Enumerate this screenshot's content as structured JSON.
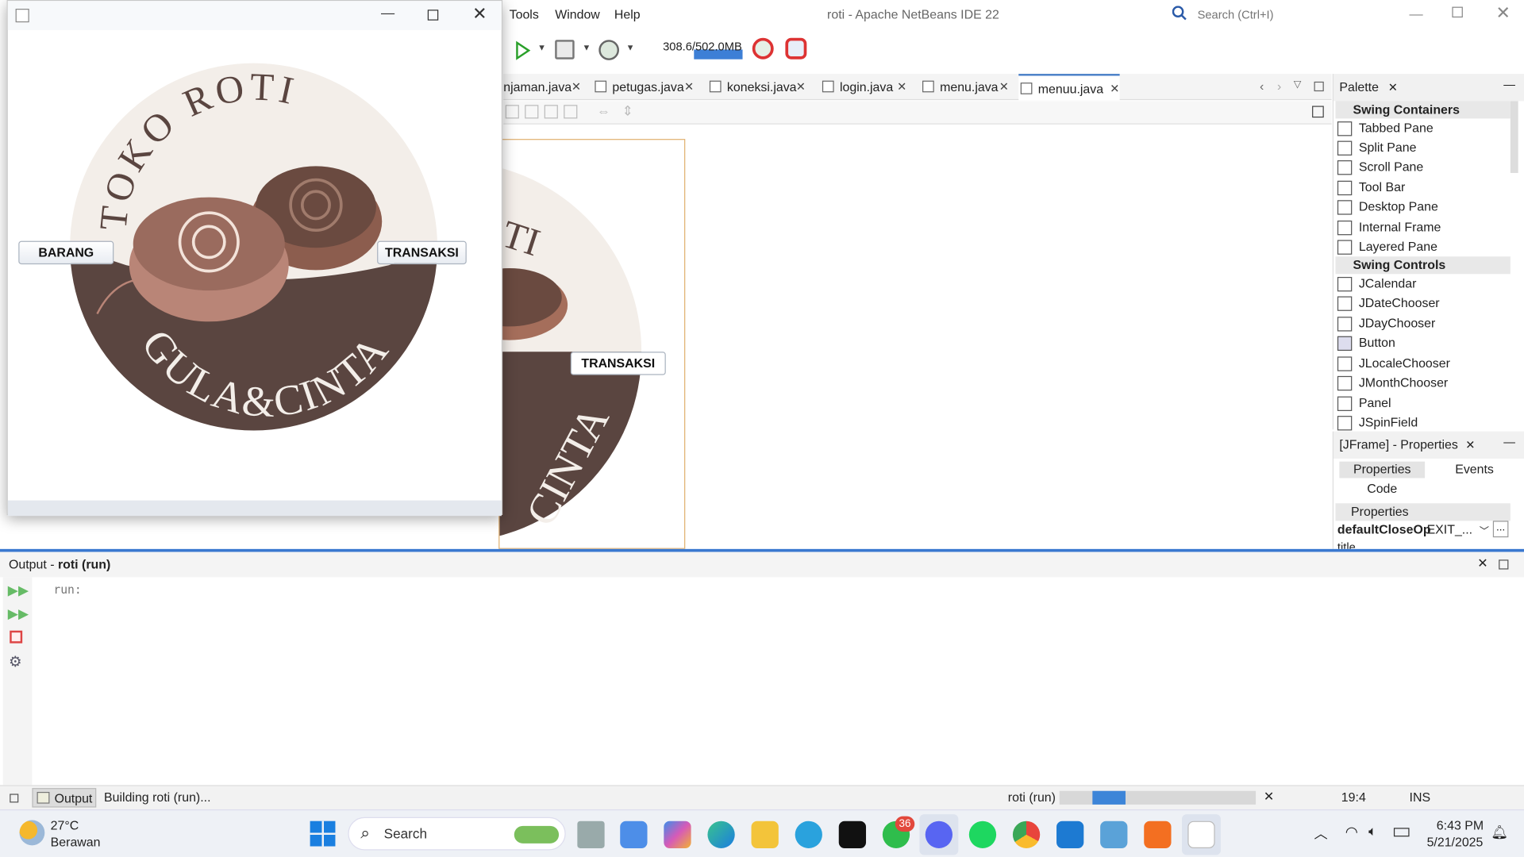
{
  "ide": {
    "menus": [
      "Tools",
      "Window",
      "Help"
    ],
    "title": "roti - Apache NetBeans IDE 22",
    "search_placeholder": "Search (Ctrl+I)",
    "memory": "308.6/502.0MB"
  },
  "editor_tabs": [
    {
      "label": "njaman.java"
    },
    {
      "label": "petugas.java"
    },
    {
      "label": "koneksi.java"
    },
    {
      "label": "login.java"
    },
    {
      "label": "menu.java"
    },
    {
      "label": "menuu.java",
      "active": true
    }
  ],
  "design": {
    "transaksi_label": "TRANSAKSI"
  },
  "palette": {
    "title": "Palette",
    "groups": [
      {
        "name": "Swing Containers",
        "items": [
          "Tabbed Pane",
          "Split Pane",
          "Scroll Pane",
          "Tool Bar",
          "Desktop Pane",
          "Internal Frame",
          "Layered Pane"
        ]
      },
      {
        "name": "Swing Controls",
        "items": [
          "JCalendar",
          "JDateChooser",
          "JDayChooser",
          "Button",
          "JLocaleChooser",
          "JMonthChooser",
          "Panel",
          "JSpinField"
        ]
      }
    ]
  },
  "properties": {
    "title": "[JFrame] - Properties",
    "tab_properties": "Properties",
    "tab_events": "Events",
    "tab_code": "Code",
    "section": "Properties",
    "row_name": "defaultCloseOp",
    "row_value": "EXIT_...",
    "row_more": "...",
    "next_row": "title"
  },
  "output": {
    "title_prefix": "Output - ",
    "title_bold": "roti (run)",
    "text": "run:"
  },
  "status": {
    "output_tab": "Output",
    "building": "Building roti (run)...",
    "run_name": "roti (run)",
    "progress": 0.2,
    "position": "19:4",
    "mode": "INS"
  },
  "app": {
    "logo_top_text": "TOKO ROTI",
    "logo_bottom_text": "GULA&CINTA",
    "barang_label": "BARANG",
    "transaksi_label": "TRANSAKSI"
  },
  "taskbar": {
    "weather_temp": "27°C",
    "weather_desc": "Berawan",
    "search": "Search",
    "whatsapp_badge": "36",
    "time": "6:43 PM",
    "date": "5/21/2025"
  },
  "colors": {
    "accent": "#3a78d0",
    "logo_dark": "#5a4540",
    "logo_light": "#f3eee9"
  }
}
